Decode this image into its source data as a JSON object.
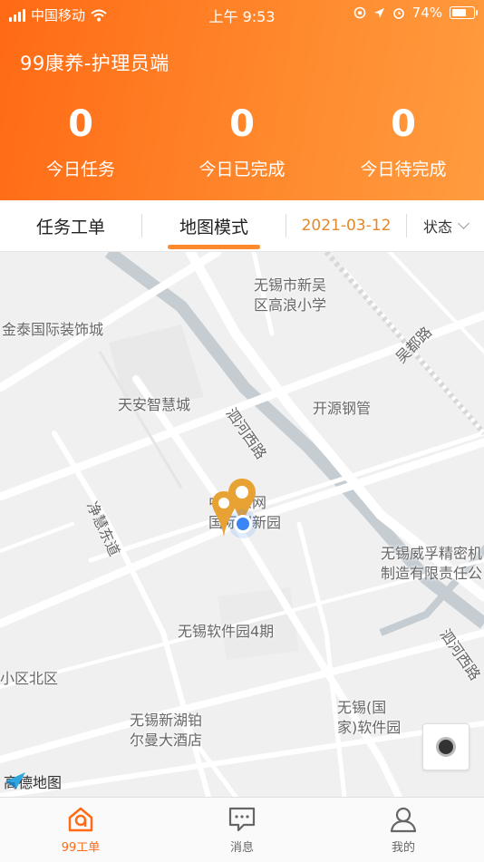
{
  "status_bar": {
    "carrier": "中国移动",
    "time": "上午 9:53",
    "battery_pct": "74%",
    "battery_level": 0.74
  },
  "app_title": "99康养-护理员端",
  "stats": [
    {
      "value": "0",
      "label": "今日任务"
    },
    {
      "value": "0",
      "label": "今日已完成"
    },
    {
      "value": "0",
      "label": "今日待完成"
    }
  ],
  "tabs": {
    "task_list": "任务工单",
    "map_mode": "地图模式",
    "date": "2021-03-12",
    "status_filter": "状态"
  },
  "map": {
    "labels": {
      "school": "无锡市新吴\n区高浪小学",
      "jintai": "金泰国际装饰城",
      "tianan": "天安智慧城",
      "kaiyuan": "开源钢管",
      "wudu_road": "吴都路",
      "xihe_road": "泗河西路",
      "xihe_road2": "泗河西路",
      "jinghui_road": "净慧东道",
      "iot_park": "中国感网\n国际创新园",
      "weifu": "无锡威孚精密机\n制造有限责任公",
      "software4": "无锡软件园4期",
      "xiaoqu": "小区北区",
      "national_soft": "无锡(国\n家)软件园",
      "hotel": "无锡新湖铂\n尔曼大酒店"
    },
    "logo": "高德地图",
    "accent": "#e8a233",
    "user_dot": "#3a86f5"
  },
  "bottom_nav": [
    {
      "label": "99工单",
      "icon": "home-99-icon",
      "active": true
    },
    {
      "label": "消息",
      "icon": "message-icon",
      "active": false
    },
    {
      "label": "我的",
      "icon": "user-icon",
      "active": false
    }
  ],
  "colors": {
    "brand": "#ff6a14",
    "date": "#e4882c"
  }
}
